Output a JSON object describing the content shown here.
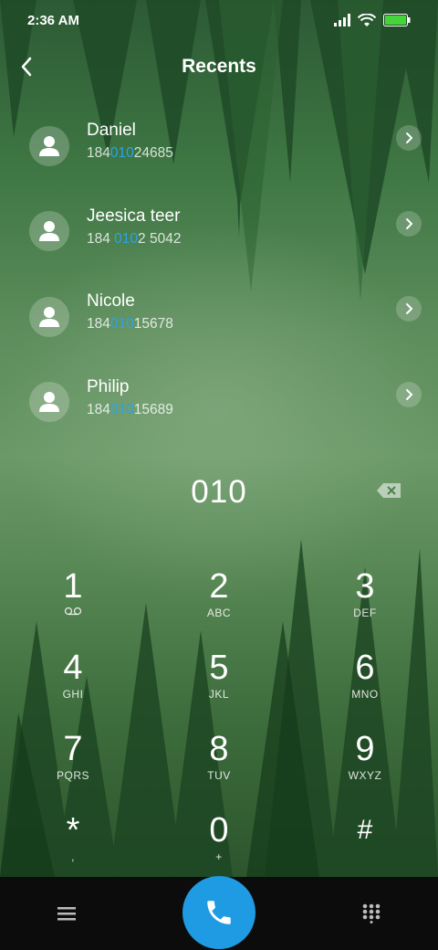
{
  "status": {
    "time": "2:36 AM",
    "icons": [
      "signal-icon",
      "wifi-icon",
      "battery-icon"
    ],
    "battery_color": "#45d53a"
  },
  "header": {
    "title": "Recents",
    "back_icon": "chevron-left-icon"
  },
  "recents": [
    {
      "name": "Daniel",
      "number_pre": "184",
      "number_match": "010",
      "number_post": "24685"
    },
    {
      "name": "Jeesica teer",
      "number_pre": "184 ",
      "number_match": "010",
      "number_post": "2 5042"
    },
    {
      "name": "Nicole",
      "number_pre": "184",
      "number_match": "010",
      "number_post": "15678"
    },
    {
      "name": "Philip",
      "number_pre": "184",
      "number_match": "010",
      "number_post": "15689"
    }
  ],
  "dialer": {
    "input": "010",
    "highlight_color": "#28a5e6"
  },
  "keypad": [
    [
      {
        "digit": "1",
        "letters": "ᴏᴏ",
        "icon": "voicemail-icon"
      },
      {
        "digit": "2",
        "letters": "ABC"
      },
      {
        "digit": "3",
        "letters": "DEF"
      }
    ],
    [
      {
        "digit": "4",
        "letters": "GHI"
      },
      {
        "digit": "5",
        "letters": "JKL"
      },
      {
        "digit": "6",
        "letters": "MNO"
      }
    ],
    [
      {
        "digit": "7",
        "letters": "PQRS"
      },
      {
        "digit": "8",
        "letters": "TUV"
      },
      {
        "digit": "9",
        "letters": "WXYZ"
      }
    ],
    [
      {
        "digit": "*",
        "letters": ","
      },
      {
        "digit": "0",
        "letters": "+"
      },
      {
        "digit": "#",
        "letters": ""
      }
    ]
  ],
  "bottom": {
    "menu_icon": "menu-icon",
    "call_icon": "phone-icon",
    "dialpad_icon": "dialpad-icon",
    "call_color": "#1e9be3"
  }
}
